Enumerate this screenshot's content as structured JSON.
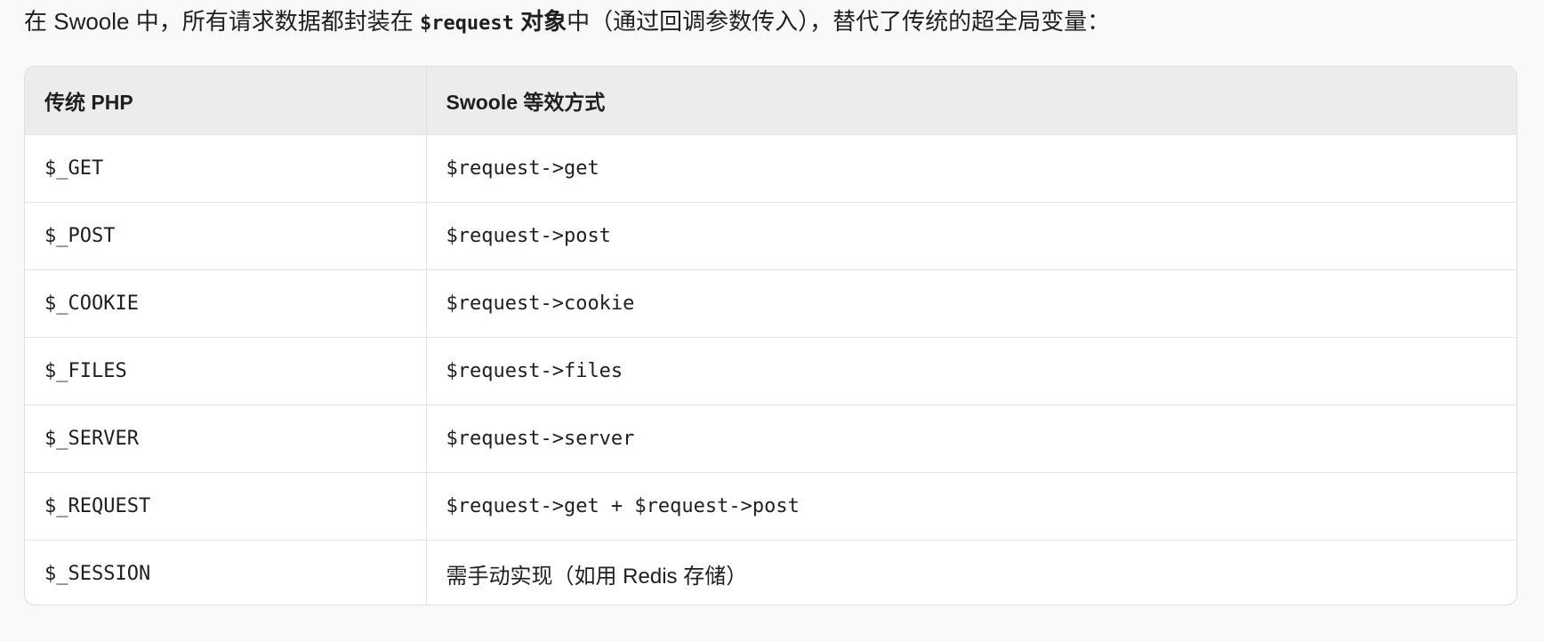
{
  "intro": {
    "prefix": "在 Swoole 中，所有请求数据都封装在 ",
    "code": "$request",
    "bold": " 对象",
    "suffix": "中（通过回调参数传入），替代了传统的超全局变量："
  },
  "table": {
    "headers": [
      "传统 PHP",
      "Swoole 等效方式"
    ],
    "rows": [
      [
        "$_GET",
        "$request->get"
      ],
      [
        "$_POST",
        "$request->post"
      ],
      [
        "$_COOKIE",
        "$request->cookie"
      ],
      [
        "$_FILES",
        "$request->files"
      ],
      [
        "$_SERVER",
        "$request->server"
      ],
      [
        "$_REQUEST",
        "$request->get + $request->post"
      ],
      [
        "$_SESSION",
        "需手动实现（如用 Redis 存储）"
      ]
    ]
  }
}
